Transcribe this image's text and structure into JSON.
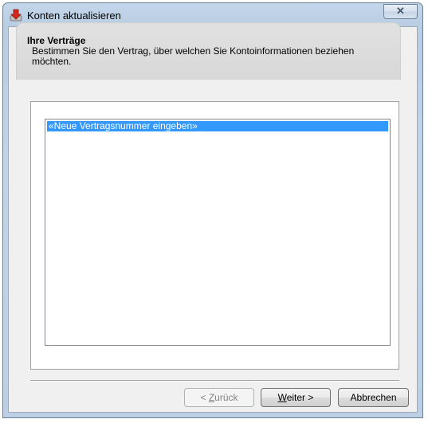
{
  "window": {
    "title": "Konten aktualisieren",
    "close_glyph": "✕"
  },
  "header": {
    "title": "Ihre Verträge",
    "description": "Bestimmen Sie den Vertrag, über welchen Sie Kontoinformationen beziehen möchten."
  },
  "contracts": {
    "items": [
      {
        "label": "«Neue Vertragsnummer eingeben»",
        "selected": true
      }
    ]
  },
  "buttons": {
    "back": {
      "prefix": "< ",
      "mnemonic": "Z",
      "rest": "urück",
      "enabled": false
    },
    "next": {
      "mnemonic": "W",
      "rest": "eiter >",
      "enabled": true
    },
    "cancel": {
      "label": "Abbrechen",
      "enabled": true
    }
  },
  "colors": {
    "selection": "#3399ff",
    "titlebar": "#c3d6ea",
    "icon_red": "#d9261c"
  }
}
